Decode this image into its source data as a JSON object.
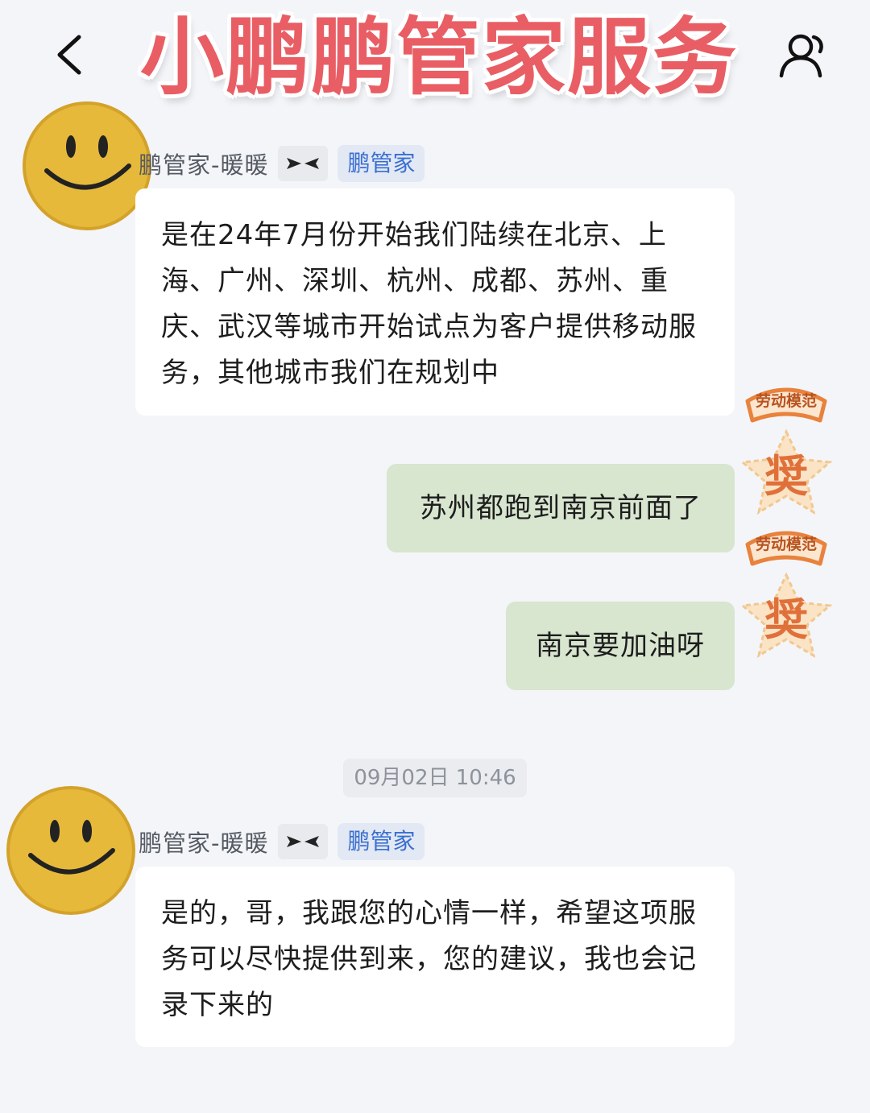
{
  "header": {
    "title": "小鹏鹏管家服务",
    "back_icon": "chevron-left-icon",
    "profile_icon": "person-icon"
  },
  "messages": [
    {
      "sender_name": "鹏管家-暖暖",
      "role_badge": "鹏管家",
      "text": "是在24年7月份开始我们陆续在北京、上海、广州、深圳、杭州、成都、苏州、重庆、武汉等城市开始试点为客户提供移动服务，其他城市我们在规划中"
    },
    {
      "text": "苏州都跑到南京前面了",
      "medal_ribbon": "劳动模范",
      "medal_char": "奨"
    },
    {
      "text": "南京要加油呀",
      "medal_ribbon": "劳动模范",
      "medal_char": "奨"
    },
    {
      "sender_name": "鹏管家-暖暖",
      "role_badge": "鹏管家",
      "text": "是的，哥，我跟您的心情一样，希望这项服务可以尽快提供到来，您的建议，我也会记录下来的"
    }
  ],
  "timestamp": "09月02日 10:46",
  "colors": {
    "title": "#e85e64",
    "outgoing_bubble": "#d8e5cf",
    "incoming_bubble": "#ffffff",
    "badge_text": "#3a6fd0",
    "background": "#f4f5f9"
  }
}
